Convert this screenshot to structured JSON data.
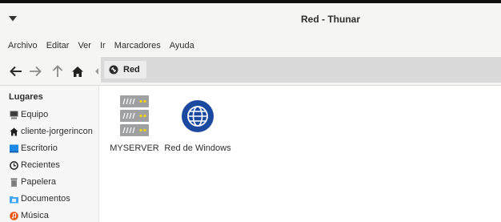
{
  "window": {
    "title": "Red - Thunar",
    "window_menu_icon": "triangle-down-icon"
  },
  "menubar": {
    "items": [
      "Archivo",
      "Editar",
      "Ver",
      "Ir",
      "Marcadores",
      "Ayuda"
    ]
  },
  "toolbar": {
    "back_icon": "arrow-left-icon",
    "forward_icon": "arrow-right-icon",
    "up_icon": "arrow-up-icon",
    "home_icon": "home-icon",
    "scroll_left_icon": "chevron-left-icon"
  },
  "pathbar": {
    "location": "Red",
    "location_icon": "network-icon"
  },
  "sidebar": {
    "heading": "Lugares",
    "items": [
      {
        "label": "Equipo",
        "icon": "computer-icon"
      },
      {
        "label": "cliente-jorgerincon",
        "icon": "home-icon"
      },
      {
        "label": "Escritorio",
        "icon": "desktop-icon"
      },
      {
        "label": "Recientes",
        "icon": "clock-icon"
      },
      {
        "label": "Papelera",
        "icon": "trash-icon"
      },
      {
        "label": "Documentos",
        "icon": "documents-folder-icon"
      },
      {
        "label": "Música",
        "icon": "music-icon"
      }
    ]
  },
  "files": [
    {
      "name": "MYSERVER",
      "icon": "server-icon"
    },
    {
      "name": "Red de Windows",
      "icon": "globe-icon"
    }
  ],
  "colors": {
    "accent": "#1f4fa3",
    "globe": "#1b49a0",
    "music": "#e8590c",
    "desktop": "#1e88e5",
    "documents": "#42a5f5"
  }
}
